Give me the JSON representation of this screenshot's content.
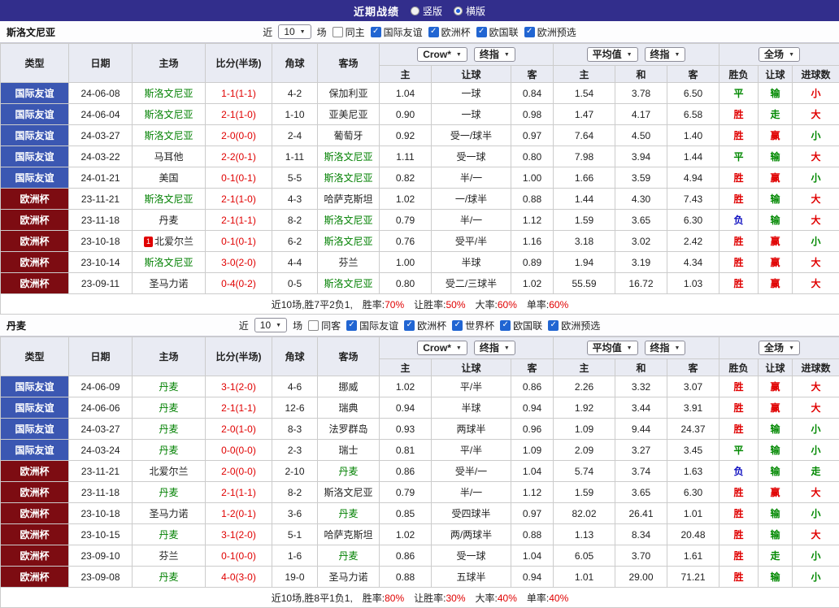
{
  "topbar": {
    "title": "近期战绩",
    "radios": [
      {
        "label": "竖版",
        "selected": false
      },
      {
        "label": "横版",
        "selected": true
      }
    ]
  },
  "icons": {
    "check": "✓",
    "caret": "▼"
  },
  "header_labels": {
    "left_cols": [
      "类型",
      "日期",
      "主场",
      "比分(半场)",
      "角球",
      "客场"
    ],
    "sub_cols": [
      "主",
      "让球",
      "客",
      "主",
      "和",
      "客",
      "胜负",
      "让球",
      "进球数"
    ]
  },
  "sections": [
    {
      "team": "斯洛文尼亚",
      "filters": {
        "pre": "近",
        "count": "10",
        "post": "场",
        "checkboxes": [
          {
            "label": "同主",
            "checked": false
          },
          {
            "label": "国际友谊",
            "checked": true
          },
          {
            "label": "欧洲杯",
            "checked": true
          },
          {
            "label": "欧国联",
            "checked": true
          },
          {
            "label": "欧洲预选",
            "checked": true
          }
        ]
      },
      "dropdowns": {
        "odds": [
          "Crow*",
          "终指"
        ],
        "avg": [
          "平均值",
          "终指"
        ],
        "scope": "全场"
      },
      "rows": [
        {
          "type": "国际友谊",
          "tc": "blue",
          "date": "24-06-08",
          "home": "斯洛文尼亚",
          "hg": 1,
          "score": "1-1(1-1)",
          "corner": "4-2",
          "away": "保加利亚",
          "ag": 0,
          "ah": [
            "1.04",
            "一球",
            "0.84"
          ],
          "eu": [
            "1.54",
            "3.78",
            "6.50"
          ],
          "wdl": [
            "平",
            "g"
          ],
          "hc": [
            "输",
            "g"
          ],
          "ou": [
            "小",
            "r"
          ]
        },
        {
          "type": "国际友谊",
          "tc": "blue",
          "date": "24-06-04",
          "home": "斯洛文尼亚",
          "hg": 1,
          "score": "2-1(1-0)",
          "corner": "1-10",
          "away": "亚美尼亚",
          "ag": 0,
          "ah": [
            "0.90",
            "一球",
            "0.98"
          ],
          "eu": [
            "1.47",
            "4.17",
            "6.58"
          ],
          "wdl": [
            "胜",
            "r"
          ],
          "hc": [
            "走",
            "g"
          ],
          "ou": [
            "大",
            "r"
          ]
        },
        {
          "type": "国际友谊",
          "tc": "blue",
          "date": "24-03-27",
          "home": "斯洛文尼亚",
          "hg": 1,
          "score": "2-0(0-0)",
          "corner": "2-4",
          "away": "葡萄牙",
          "ag": 0,
          "ah": [
            "0.92",
            "受一/球半",
            "0.97"
          ],
          "eu": [
            "7.64",
            "4.50",
            "1.40"
          ],
          "wdl": [
            "胜",
            "r"
          ],
          "hc": [
            "赢",
            "r"
          ],
          "ou": [
            "小",
            "g"
          ]
        },
        {
          "type": "国际友谊",
          "tc": "blue",
          "date": "24-03-22",
          "home": "马耳他",
          "hg": 0,
          "score": "2-2(0-1)",
          "corner": "1-11",
          "away": "斯洛文尼亚",
          "ag": 1,
          "ah": [
            "1.11",
            "受一球",
            "0.80"
          ],
          "eu": [
            "7.98",
            "3.94",
            "1.44"
          ],
          "wdl": [
            "平",
            "g"
          ],
          "hc": [
            "输",
            "g"
          ],
          "ou": [
            "大",
            "r"
          ]
        },
        {
          "type": "国际友谊",
          "tc": "blue",
          "date": "24-01-21",
          "home": "美国",
          "hg": 0,
          "score": "0-1(0-1)",
          "corner": "5-5",
          "away": "斯洛文尼亚",
          "ag": 1,
          "ah": [
            "0.82",
            "半/一",
            "1.00"
          ],
          "eu": [
            "1.66",
            "3.59",
            "4.94"
          ],
          "wdl": [
            "胜",
            "r"
          ],
          "hc": [
            "赢",
            "r"
          ],
          "ou": [
            "小",
            "g"
          ]
        },
        {
          "type": "欧洲杯",
          "tc": "maroon",
          "date": "23-11-21",
          "home": "斯洛文尼亚",
          "hg": 1,
          "score": "2-1(1-0)",
          "corner": "4-3",
          "away": "哈萨克斯坦",
          "ag": 0,
          "ah": [
            "1.02",
            "一/球半",
            "0.88"
          ],
          "eu": [
            "1.44",
            "4.30",
            "7.43"
          ],
          "wdl": [
            "胜",
            "r"
          ],
          "hc": [
            "输",
            "g"
          ],
          "ou": [
            "大",
            "r"
          ]
        },
        {
          "type": "欧洲杯",
          "tc": "maroon",
          "date": "23-11-18",
          "home": "丹麦",
          "hg": 0,
          "score": "2-1(1-1)",
          "corner": "8-2",
          "away": "斯洛文尼亚",
          "ag": 1,
          "ah": [
            "0.79",
            "半/一",
            "1.12"
          ],
          "eu": [
            "1.59",
            "3.65",
            "6.30"
          ],
          "wdl": [
            "负",
            "b"
          ],
          "hc": [
            "输",
            "g"
          ],
          "ou": [
            "大",
            "r"
          ]
        },
        {
          "type": "欧洲杯",
          "tc": "maroon",
          "date": "23-10-18",
          "home": "北爱尔兰",
          "hg": 0,
          "badge": "1",
          "score": "0-1(0-1)",
          "corner": "6-2",
          "away": "斯洛文尼亚",
          "ag": 1,
          "ah": [
            "0.76",
            "受平/半",
            "1.16"
          ],
          "eu": [
            "3.18",
            "3.02",
            "2.42"
          ],
          "wdl": [
            "胜",
            "r"
          ],
          "hc": [
            "赢",
            "r"
          ],
          "ou": [
            "小",
            "g"
          ]
        },
        {
          "type": "欧洲杯",
          "tc": "maroon",
          "date": "23-10-14",
          "home": "斯洛文尼亚",
          "hg": 1,
          "score": "3-0(2-0)",
          "corner": "4-4",
          "away": "芬兰",
          "ag": 0,
          "ah": [
            "1.00",
            "半球",
            "0.89"
          ],
          "eu": [
            "1.94",
            "3.19",
            "4.34"
          ],
          "wdl": [
            "胜",
            "r"
          ],
          "hc": [
            "赢",
            "r"
          ],
          "ou": [
            "大",
            "r"
          ]
        },
        {
          "type": "欧洲杯",
          "tc": "maroon",
          "date": "23-09-11",
          "home": "圣马力诺",
          "hg": 0,
          "score": "0-4(0-2)",
          "corner": "0-5",
          "away": "斯洛文尼亚",
          "ag": 1,
          "ah": [
            "0.80",
            "受二/三球半",
            "1.02"
          ],
          "eu": [
            "55.59",
            "16.72",
            "1.03"
          ],
          "wdl": [
            "胜",
            "r"
          ],
          "hc": [
            "赢",
            "r"
          ],
          "ou": [
            "大",
            "r"
          ]
        }
      ],
      "summary": {
        "prefix": "近10场,胜7平2负1,",
        "stats": [
          {
            "label": "胜率:",
            "value": "70%"
          },
          {
            "label": "让胜率:",
            "value": "50%"
          },
          {
            "label": "大率:",
            "value": "60%"
          },
          {
            "label": "单率:",
            "value": "60%"
          }
        ]
      }
    },
    {
      "team": "丹麦",
      "filters": {
        "pre": "近",
        "count": "10",
        "post": "场",
        "checkboxes": [
          {
            "label": "同客",
            "checked": false
          },
          {
            "label": "国际友谊",
            "checked": true
          },
          {
            "label": "欧洲杯",
            "checked": true
          },
          {
            "label": "世界杯",
            "checked": true
          },
          {
            "label": "欧国联",
            "checked": true
          },
          {
            "label": "欧洲预选",
            "checked": true
          }
        ]
      },
      "dropdowns": {
        "odds": [
          "Crow*",
          "终指"
        ],
        "avg": [
          "平均值",
          "终指"
        ],
        "scope": "全场"
      },
      "rows": [
        {
          "type": "国际友谊",
          "tc": "blue",
          "date": "24-06-09",
          "home": "丹麦",
          "hg": 1,
          "score": "3-1(2-0)",
          "corner": "4-6",
          "away": "挪威",
          "ag": 0,
          "ah": [
            "1.02",
            "平/半",
            "0.86"
          ],
          "eu": [
            "2.26",
            "3.32",
            "3.07"
          ],
          "wdl": [
            "胜",
            "r"
          ],
          "hc": [
            "赢",
            "r"
          ],
          "ou": [
            "大",
            "r"
          ]
        },
        {
          "type": "国际友谊",
          "tc": "blue",
          "date": "24-06-06",
          "home": "丹麦",
          "hg": 1,
          "score": "2-1(1-1)",
          "corner": "12-6",
          "away": "瑞典",
          "ag": 0,
          "ah": [
            "0.94",
            "半球",
            "0.94"
          ],
          "eu": [
            "1.92",
            "3.44",
            "3.91"
          ],
          "wdl": [
            "胜",
            "r"
          ],
          "hc": [
            "赢",
            "r"
          ],
          "ou": [
            "大",
            "r"
          ]
        },
        {
          "type": "国际友谊",
          "tc": "blue",
          "date": "24-03-27",
          "home": "丹麦",
          "hg": 1,
          "score": "2-0(1-0)",
          "corner": "8-3",
          "away": "法罗群岛",
          "ag": 0,
          "ah": [
            "0.93",
            "两球半",
            "0.96"
          ],
          "eu": [
            "1.09",
            "9.44",
            "24.37"
          ],
          "wdl": [
            "胜",
            "r"
          ],
          "hc": [
            "输",
            "g"
          ],
          "ou": [
            "小",
            "g"
          ]
        },
        {
          "type": "国际友谊",
          "tc": "blue",
          "date": "24-03-24",
          "home": "丹麦",
          "hg": 1,
          "score": "0-0(0-0)",
          "corner": "2-3",
          "away": "瑞士",
          "ag": 0,
          "ah": [
            "0.81",
            "平/半",
            "1.09"
          ],
          "eu": [
            "2.09",
            "3.27",
            "3.45"
          ],
          "wdl": [
            "平",
            "g"
          ],
          "hc": [
            "输",
            "g"
          ],
          "ou": [
            "小",
            "g"
          ]
        },
        {
          "type": "欧洲杯",
          "tc": "maroon",
          "date": "23-11-21",
          "home": "北爱尔兰",
          "hg": 0,
          "score": "2-0(0-0)",
          "corner": "2-10",
          "away": "丹麦",
          "ag": 1,
          "ah": [
            "0.86",
            "受半/一",
            "1.04"
          ],
          "eu": [
            "5.74",
            "3.74",
            "1.63"
          ],
          "wdl": [
            "负",
            "b"
          ],
          "hc": [
            "输",
            "g"
          ],
          "ou": [
            "走",
            "g"
          ]
        },
        {
          "type": "欧洲杯",
          "tc": "maroon",
          "date": "23-11-18",
          "home": "丹麦",
          "hg": 1,
          "score": "2-1(1-1)",
          "corner": "8-2",
          "away": "斯洛文尼亚",
          "ag": 0,
          "ah": [
            "0.79",
            "半/一",
            "1.12"
          ],
          "eu": [
            "1.59",
            "3.65",
            "6.30"
          ],
          "wdl": [
            "胜",
            "r"
          ],
          "hc": [
            "赢",
            "r"
          ],
          "ou": [
            "大",
            "r"
          ]
        },
        {
          "type": "欧洲杯",
          "tc": "maroon",
          "date": "23-10-18",
          "home": "圣马力诺",
          "hg": 0,
          "score": "1-2(0-1)",
          "corner": "3-6",
          "away": "丹麦",
          "ag": 1,
          "ah": [
            "0.85",
            "受四球半",
            "0.97"
          ],
          "eu": [
            "82.02",
            "26.41",
            "1.01"
          ],
          "wdl": [
            "胜",
            "r"
          ],
          "hc": [
            "输",
            "g"
          ],
          "ou": [
            "小",
            "g"
          ]
        },
        {
          "type": "欧洲杯",
          "tc": "maroon",
          "date": "23-10-15",
          "home": "丹麦",
          "hg": 1,
          "score": "3-1(2-0)",
          "corner": "5-1",
          "away": "哈萨克斯坦",
          "ag": 0,
          "ah": [
            "1.02",
            "两/两球半",
            "0.88"
          ],
          "eu": [
            "1.13",
            "8.34",
            "20.48"
          ],
          "wdl": [
            "胜",
            "r"
          ],
          "hc": [
            "输",
            "g"
          ],
          "ou": [
            "大",
            "r"
          ]
        },
        {
          "type": "欧洲杯",
          "tc": "maroon",
          "date": "23-09-10",
          "home": "芬兰",
          "hg": 0,
          "score": "0-1(0-0)",
          "corner": "1-6",
          "away": "丹麦",
          "ag": 1,
          "ah": [
            "0.86",
            "受一球",
            "1.04"
          ],
          "eu": [
            "6.05",
            "3.70",
            "1.61"
          ],
          "wdl": [
            "胜",
            "r"
          ],
          "hc": [
            "走",
            "g"
          ],
          "ou": [
            "小",
            "g"
          ]
        },
        {
          "type": "欧洲杯",
          "tc": "maroon",
          "date": "23-09-08",
          "home": "丹麦",
          "hg": 1,
          "score": "4-0(3-0)",
          "corner": "19-0",
          "away": "圣马力诺",
          "ag": 0,
          "ah": [
            "0.88",
            "五球半",
            "0.94"
          ],
          "eu": [
            "1.01",
            "29.00",
            "71.21"
          ],
          "wdl": [
            "胜",
            "r"
          ],
          "hc": [
            "输",
            "g"
          ],
          "ou": [
            "小",
            "g"
          ]
        }
      ],
      "summary": {
        "prefix": "近10场,胜8平1负1,",
        "stats": [
          {
            "label": "胜率:",
            "value": "80%"
          },
          {
            "label": "让胜率:",
            "value": "30%"
          },
          {
            "label": "大率:",
            "value": "40%"
          },
          {
            "label": "单率:",
            "value": "40%"
          }
        ]
      }
    }
  ]
}
